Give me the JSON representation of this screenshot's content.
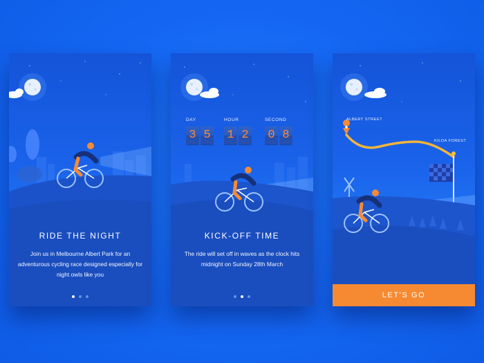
{
  "screens": [
    {
      "title": "RIDE THE NIGHT",
      "description": "Join us in Melbourne Albert Park for an adventurous cycling race designed especially for night owls like you",
      "page_indicator": {
        "count": 3,
        "active": 1
      }
    },
    {
      "title": "KICK-OFF TIME",
      "description": "The ride will set off in waves as the clock hits midnight on Sunday 28th March",
      "countdown": {
        "day_label": "DAY",
        "hour_label": "HOUR",
        "second_label": "SECOND",
        "digits": [
          "3",
          "5",
          "1",
          "2",
          "0",
          "8"
        ]
      },
      "page_indicator": {
        "count": 3,
        "active": 2
      }
    },
    {
      "map": {
        "start_label": "ALBERT STREET",
        "end_label": "KILDA FOREST"
      },
      "cta_label": "LET'S GO"
    }
  ],
  "colors": {
    "background": "#1466f2",
    "accent": "#f68a32",
    "screen": "#1a63ea"
  },
  "icons": [
    "moon-icon",
    "cloud-icon",
    "cyclist-illustration",
    "location-pin-icon",
    "checkered-flag-icon",
    "windmill-icon"
  ]
}
